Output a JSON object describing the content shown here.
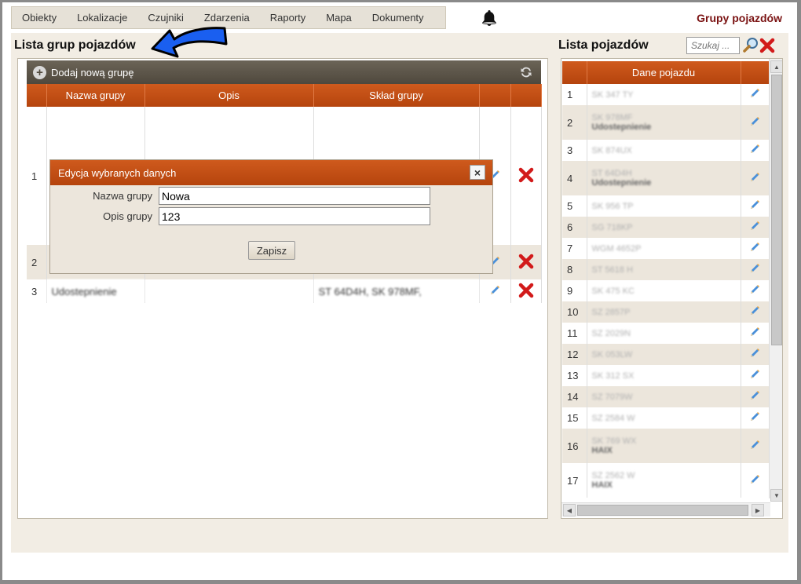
{
  "nav": {
    "items": [
      "Obiekty",
      "Lokalizacje",
      "Czujniki",
      "Zdarzenia",
      "Raporty",
      "Mapa",
      "Dokumenty"
    ]
  },
  "header": {
    "page_title": "Grupy pojazdów"
  },
  "group_list": {
    "title": "Lista grup pojazdów",
    "add_label": "Dodaj nową grupę",
    "columns": [
      "",
      "Nazwa grupy",
      "Opis",
      "Skład grupy",
      "",
      ""
    ],
    "rows": [
      {
        "num": "1",
        "name": "",
        "desc": "",
        "members": ""
      },
      {
        "num": "2",
        "name": "",
        "desc": "",
        "members": ""
      },
      {
        "num": "3",
        "name": "Udostepnienie",
        "desc": "",
        "members": "ST 64D4H, SK 978MF,"
      }
    ]
  },
  "modal": {
    "title": "Edycja wybranych danych",
    "close_label": "×",
    "name_label": "Nazwa grupy",
    "name_value": "Nowa",
    "desc_label": "Opis grupy",
    "desc_value": "123",
    "save_label": "Zapisz"
  },
  "vehicle_list": {
    "title": "Lista pojazdów",
    "search_placeholder": "Szukaj ...",
    "column_header": "Dane pojazdu",
    "rows": [
      {
        "num": "1",
        "line1": "SK 347 TY",
        "line2": ""
      },
      {
        "num": "2",
        "line1": "SK 978MF",
        "line2": "Udostepnienie"
      },
      {
        "num": "3",
        "line1": "SK 874UX",
        "line2": ""
      },
      {
        "num": "4",
        "line1": "ST 64D4H",
        "line2": "Udostepnienie"
      },
      {
        "num": "5",
        "line1": "SK 956 TP",
        "line2": ""
      },
      {
        "num": "6",
        "line1": "SG 718KP",
        "line2": ""
      },
      {
        "num": "7",
        "line1": "WGM 4652P",
        "line2": ""
      },
      {
        "num": "8",
        "line1": "ST 5618 H",
        "line2": ""
      },
      {
        "num": "9",
        "line1": "SK 475 KC",
        "line2": ""
      },
      {
        "num": "10",
        "line1": "SZ 2857P",
        "line2": ""
      },
      {
        "num": "11",
        "line1": "SZ 2029N",
        "line2": ""
      },
      {
        "num": "12",
        "line1": "SK 053LW",
        "line2": ""
      },
      {
        "num": "13",
        "line1": "SK 312 SX",
        "line2": ""
      },
      {
        "num": "14",
        "line1": "SZ 7079W",
        "line2": ""
      },
      {
        "num": "15",
        "line1": "SZ 2584 W",
        "line2": ""
      },
      {
        "num": "16",
        "line1": "SK 769 WX",
        "line2": "HAIX"
      },
      {
        "num": "17",
        "line1": "SZ 2562 W",
        "line2": "HAIX"
      }
    ]
  },
  "colors": {
    "accent": "#c04f14",
    "title_red": "#7a1212",
    "toolbar": "#5b5448",
    "beige": "#f2ede4"
  }
}
